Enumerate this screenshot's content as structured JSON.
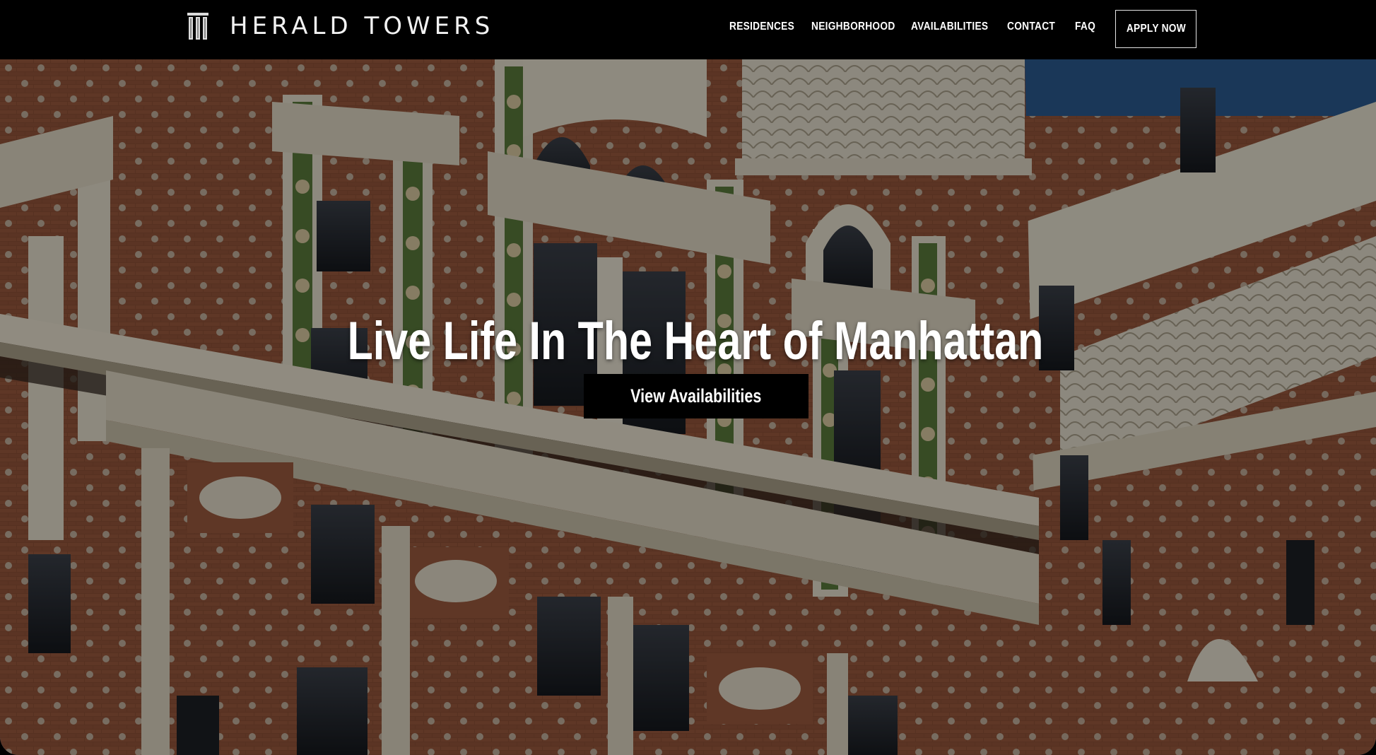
{
  "brand": {
    "name": "HERALD TOWERS",
    "logo_icon": "building-columns-icon"
  },
  "nav": {
    "links": [
      {
        "label": "RESIDENCES"
      },
      {
        "label": "NEIGHBORHOOD"
      },
      {
        "label": "AVAILABILITIES"
      },
      {
        "label": "CONTACT"
      },
      {
        "label": "FAQ"
      }
    ],
    "apply_label": "APPLY NOW"
  },
  "hero": {
    "title": "Live Life In The Heart of Manhattan",
    "cta_label": "View Availabilities"
  },
  "colors": {
    "nav_bg": "#000000",
    "text": "#ffffff",
    "brick": "#8a4a32",
    "stone": "#d9d2c0",
    "sky": "#2d5a8c"
  }
}
